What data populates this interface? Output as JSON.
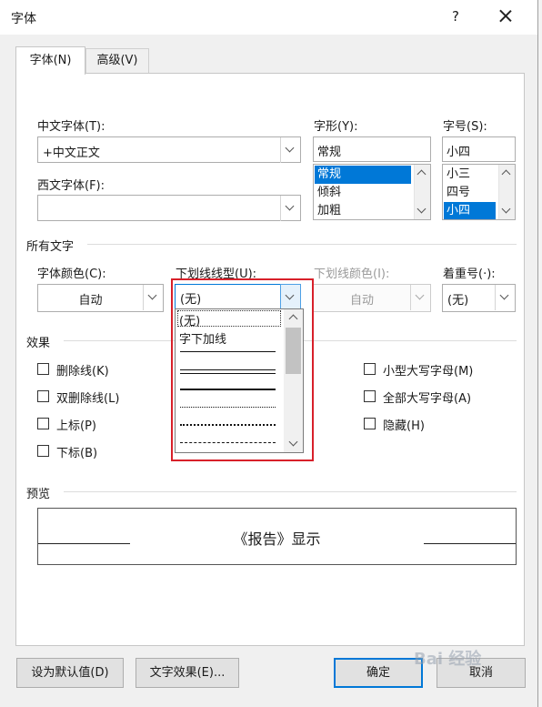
{
  "dialog": {
    "title": "字体",
    "help": "?"
  },
  "tabs": [
    {
      "label": "字体(N)"
    },
    {
      "label": "高级(V)"
    }
  ],
  "fonts": {
    "chinese_label": "中文字体(T):",
    "chinese_value": "+中文正文",
    "western_label": "西文字体(F):",
    "western_value": "",
    "style_label": "字形(Y):",
    "style_value": "常规",
    "style_options": [
      "常规",
      "倾斜",
      "加粗"
    ],
    "style_selected": "常规",
    "size_label": "字号(S):",
    "size_value": "小四",
    "size_options": [
      "小三",
      "四号",
      "小四"
    ],
    "size_selected": "小四"
  },
  "all_text": {
    "section": "所有文字",
    "color_label": "字体颜色(C):",
    "color_value": "自动",
    "underline_style_label": "下划线线型(U):",
    "underline_style_value": "(无)",
    "underline_color_label": "下划线颜色(I):",
    "underline_color_value": "自动",
    "emphasis_label": "着重号(·):",
    "emphasis_value": "(无)"
  },
  "underline_dropdown": {
    "items": [
      {
        "label": "(无)",
        "kind": "text"
      },
      {
        "label": "字下加线",
        "kind": "text"
      },
      {
        "kind": "line",
        "style": "single-thin"
      },
      {
        "kind": "line",
        "style": "double"
      },
      {
        "kind": "line",
        "style": "thick"
      },
      {
        "kind": "line",
        "style": "dotted"
      },
      {
        "kind": "line",
        "style": "dotted-heavy"
      },
      {
        "kind": "line",
        "style": "dashed"
      }
    ],
    "highlighted": "(无)"
  },
  "effects": {
    "section": "效果",
    "left": [
      {
        "label": "删除线(K)",
        "checked": false
      },
      {
        "label": "双删除线(L)",
        "checked": false
      },
      {
        "label": "上标(P)",
        "checked": false
      },
      {
        "label": "下标(B)",
        "checked": false
      }
    ],
    "right": [
      {
        "label": "小型大写字母(M)",
        "checked": false
      },
      {
        "label": "全部大写字母(A)",
        "checked": false
      },
      {
        "label": "隐藏(H)",
        "checked": false
      }
    ]
  },
  "preview": {
    "section": "预览",
    "text": "《报告》显示"
  },
  "buttons": {
    "set_default": "设为默认值(D)",
    "text_effects": "文字效果(E)...",
    "ok": "确定",
    "cancel": "取消"
  },
  "watermark": "Bai 经验",
  "colors": {
    "accent": "#0078d7",
    "annotation": "#d8202a",
    "dialog_bg": "#f0f0f0"
  }
}
